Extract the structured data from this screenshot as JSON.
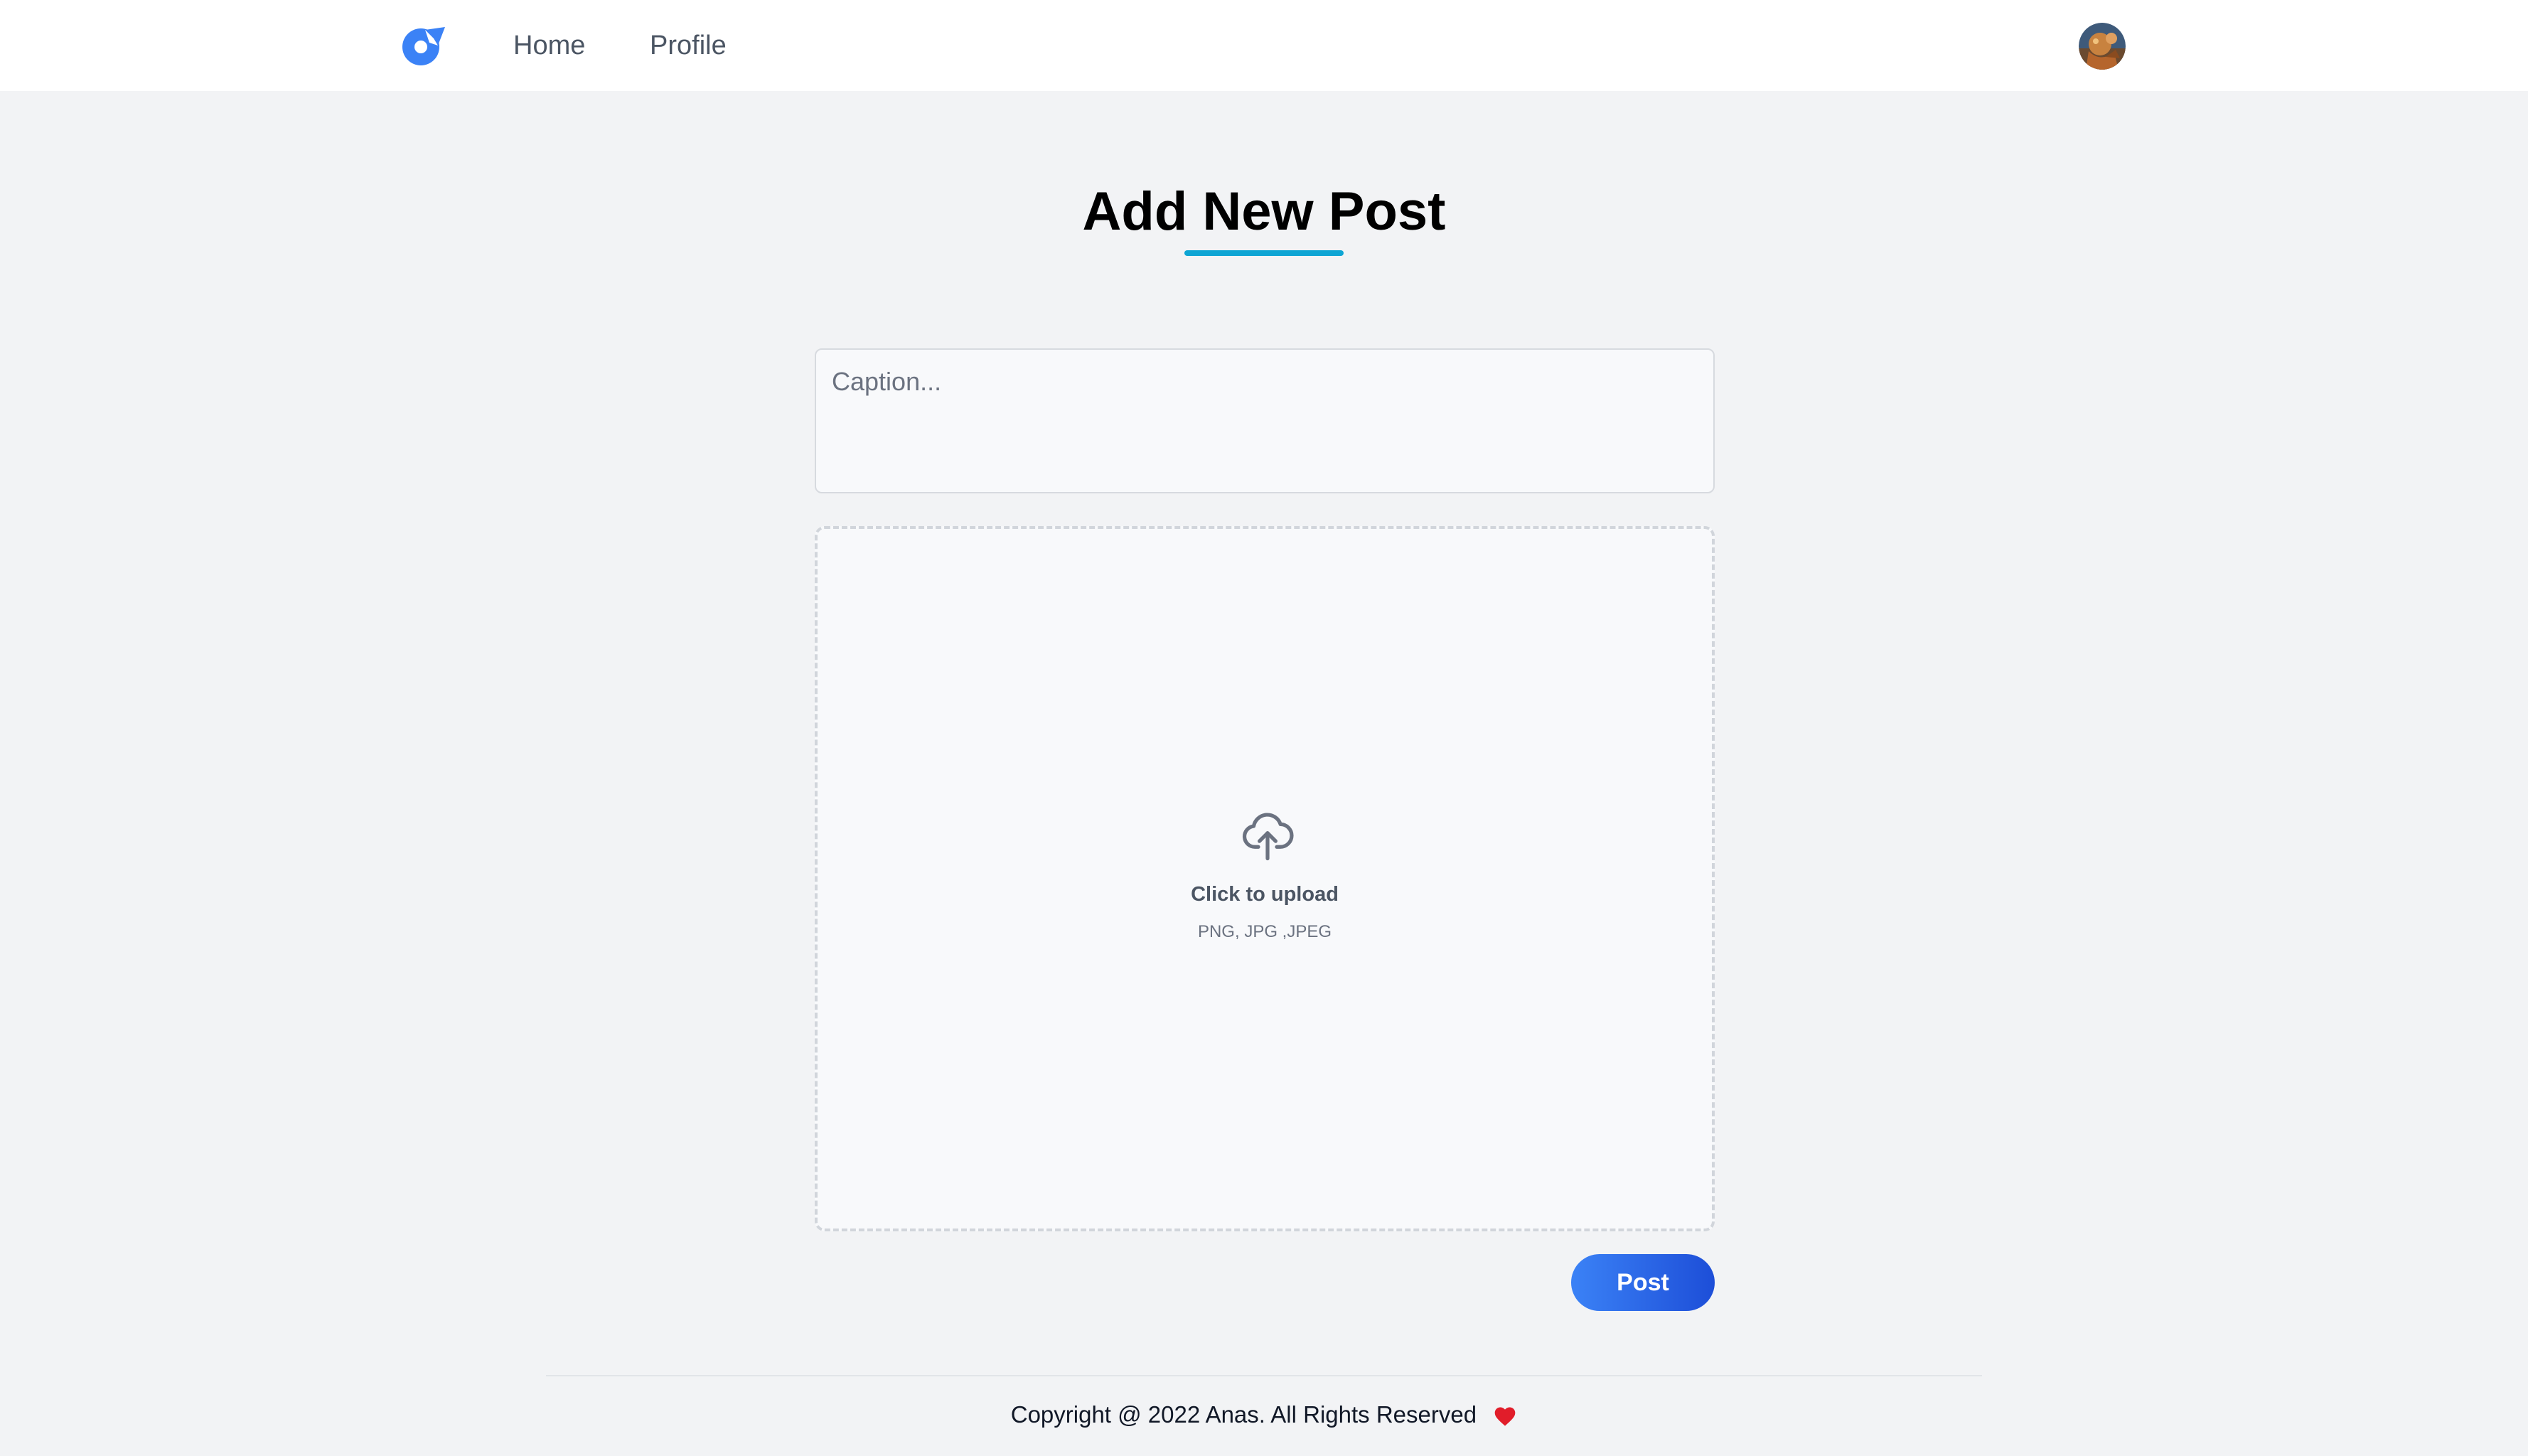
{
  "nav": {
    "logo_icon": "brand-logo-icon",
    "links": [
      {
        "label": "Home"
      },
      {
        "label": "Profile"
      }
    ],
    "avatar_icon": "user-avatar"
  },
  "main": {
    "title": "Add New Post",
    "caption": {
      "placeholder": "Caption...",
      "value": ""
    },
    "upload": {
      "icon": "cloud-upload-icon",
      "title": "Click to upload",
      "formats": "PNG, JPG ,JPEG"
    },
    "post_label": "Post"
  },
  "footer": {
    "text": "Copyright @ 2022 Anas. All Rights Reserved",
    "heart_icon": "heart-icon"
  },
  "colors": {
    "accent": "#3b82f6",
    "title_underline": "#0ea5d4",
    "background": "#f2f3f5",
    "heart": "#e11d2a"
  }
}
